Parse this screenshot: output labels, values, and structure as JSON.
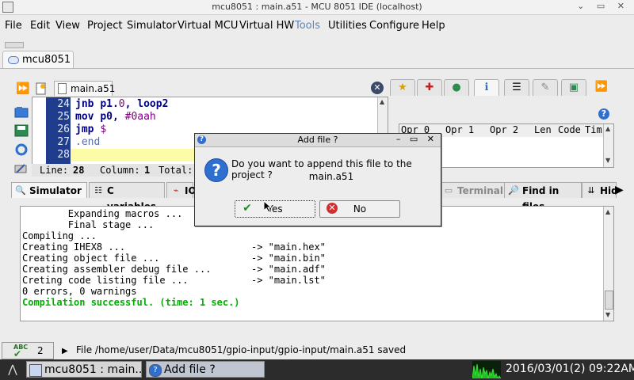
{
  "window": {
    "title": "mcu8051 : main.a51 - MCU 8051 IDE (localhost)",
    "controls": "⌄ ▭ ✕"
  },
  "menu": [
    {
      "label": "File"
    },
    {
      "label": "Edit"
    },
    {
      "label": "View"
    },
    {
      "label": "Project"
    },
    {
      "label": "Simulator"
    },
    {
      "label": "Virtual MCU"
    },
    {
      "label": "Virtual HW"
    },
    {
      "label": "Tools"
    },
    {
      "label": "Utilities"
    },
    {
      "label": "Configure"
    },
    {
      "label": "Help"
    }
  ],
  "project_tab": {
    "label": "mcu8051"
  },
  "editor": {
    "tab_label": "main.a51",
    "lines": [
      {
        "num": "24",
        "code": [
          {
            "cls": "kw",
            "t": "jnb "
          },
          {
            "cls": "kw",
            "t": "p1."
          },
          {
            "cls": "num",
            "t": "0"
          },
          {
            "cls": "kw",
            "t": ", loop2"
          }
        ]
      },
      {
        "num": "25",
        "code": [
          {
            "cls": "kw",
            "t": "mov "
          },
          {
            "cls": "kw",
            "t": "p0, "
          },
          {
            "cls": "num",
            "t": "#0aah"
          }
        ]
      },
      {
        "num": "26",
        "code": [
          {
            "cls": "kw",
            "t": "jmp "
          },
          {
            "cls": "num",
            "t": "$"
          }
        ]
      },
      {
        "num": "27",
        "code": [
          {
            "cls": "dir",
            "t": ".end"
          }
        ]
      },
      {
        "num": "28",
        "code": []
      }
    ],
    "status": {
      "line_label": "Line:",
      "line": "28",
      "col_label": "Column:",
      "col": "1",
      "total_label": "Total:"
    }
  },
  "instr_table": {
    "headers": [
      "Opr 0",
      "Opr 1",
      "Opr 2",
      "Len",
      "Code",
      "Tim"
    ]
  },
  "bottom_tabs": [
    {
      "label": "Simulator",
      "icon": "magnifier-icon"
    },
    {
      "label": "C variables",
      "icon": "list-icon"
    },
    {
      "label": "IO",
      "icon": "io-icon"
    },
    {
      "label": "Terminal",
      "icon": "terminal-icon"
    },
    {
      "label": "Find in files",
      "icon": "find-icon"
    },
    {
      "label": "Hid",
      "icon": "hide-icon"
    }
  ],
  "messages": [
    {
      "t": "        Expanding macros ...",
      "ok": false
    },
    {
      "t": "        Final stage ...",
      "ok": false
    },
    {
      "t": "Compiling ...",
      "ok": false
    },
    {
      "t": "Creating IHEX8 ...                      -> \"main.hex\"",
      "ok": false
    },
    {
      "t": "Creating object file ...                -> \"main.bin\"",
      "ok": false
    },
    {
      "t": "Creating assembler debug file ...       -> \"main.adf\"",
      "ok": false
    },
    {
      "t": "Creting code listing file ...           -> \"main.lst\"",
      "ok": false
    },
    {
      "t": "0 errors, 0 warnings",
      "ok": false
    },
    {
      "t": "Compilation successful. (time: 1 sec.)",
      "ok": true
    }
  ],
  "statusbar": {
    "spell_count": "2",
    "spell_label": "ABC",
    "message": "File /home/user/Data/mcu8051/gpio-input/gpio-input/main.a51 saved"
  },
  "taskbar": {
    "tasks": [
      {
        "label": "mcu8051 : main...."
      },
      {
        "label": "Add file ?"
      }
    ],
    "clock": "2016/03/01(2) 09:22AM"
  },
  "dialog": {
    "title": "Add file ?",
    "controls": "– ▭ ✕",
    "line1": "Do you want to append this file to the project ?",
    "line2": "main.a51",
    "yes": "Yes",
    "no": "No"
  },
  "colors": {
    "gutter": "#1f3d8c",
    "current_line": "#fbfba8",
    "success": "#00b000",
    "accent": "#2f6fd0"
  }
}
